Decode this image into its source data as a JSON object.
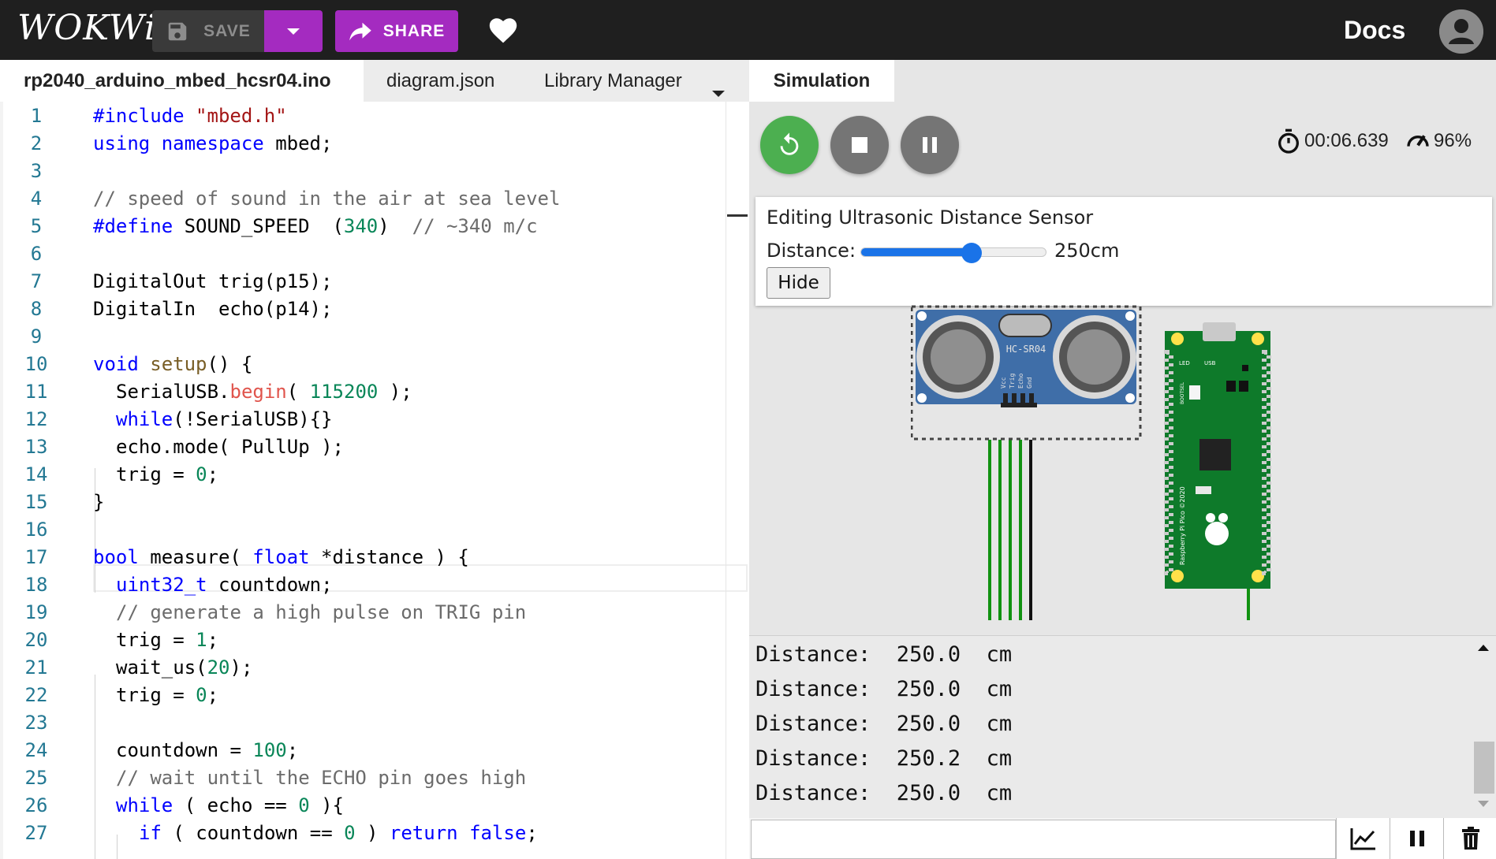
{
  "app": {
    "logo_text": "WOKWi",
    "save_label": "SAVE",
    "share_label": "SHARE",
    "docs_label": "Docs",
    "accent_color": "#a42bc0"
  },
  "editor": {
    "tabs": [
      {
        "label": "rp2040_arduino_mbed_hcsr04.ino",
        "active": true
      },
      {
        "label": "diagram.json",
        "active": false
      },
      {
        "label": "Library Manager",
        "active": false
      }
    ],
    "current_line": 14,
    "lines": [
      {
        "n": "1"
      },
      {
        "n": "2"
      },
      {
        "n": "3"
      },
      {
        "n": "4"
      },
      {
        "n": "5"
      },
      {
        "n": "6"
      },
      {
        "n": "7"
      },
      {
        "n": "8"
      },
      {
        "n": "9"
      },
      {
        "n": "10"
      },
      {
        "n": "11"
      },
      {
        "n": "12"
      },
      {
        "n": "13"
      },
      {
        "n": "14"
      },
      {
        "n": "15"
      },
      {
        "n": "16"
      },
      {
        "n": "17"
      },
      {
        "n": "18"
      },
      {
        "n": "19"
      },
      {
        "n": "20"
      },
      {
        "n": "21"
      },
      {
        "n": "22"
      },
      {
        "n": "23"
      },
      {
        "n": "24"
      },
      {
        "n": "25"
      },
      {
        "n": "26"
      },
      {
        "n": "27"
      }
    ],
    "code": {
      "l1": [
        "#include",
        " ",
        "\"mbed.h\""
      ],
      "l2": [
        "using",
        " ",
        "namespace",
        " mbed;"
      ],
      "l4": "// speed of sound in the air at sea level",
      "l5": [
        "#define",
        " SOUND_SPEED  (",
        "340",
        ")  ",
        "// ~340 m/c"
      ],
      "l7": "DigitalOut trig(p15);",
      "l8": "DigitalIn  echo(p14);",
      "l10": [
        "void",
        " ",
        "setup",
        "() {"
      ],
      "l11": [
        "SerialUSB.",
        "begin",
        "( ",
        "115200",
        " );"
      ],
      "l12": [
        "while",
        "(!SerialUSB){}"
      ],
      "l13": "echo.mode( PullUp );",
      "l14": [
        "trig = ",
        "0",
        ";"
      ],
      "l15": "}",
      "l17": [
        "bool",
        " measure( ",
        "float",
        " *distance ) {"
      ],
      "l18": [
        "uint32_t",
        " countdown;"
      ],
      "l19": "// generate a high pulse on TRIG pin",
      "l20": [
        "trig = ",
        "1",
        ";"
      ],
      "l21": [
        "wait_us(",
        "20",
        ");"
      ],
      "l22": [
        "trig = ",
        "0",
        ";"
      ],
      "l24": [
        "countdown = ",
        "100",
        ";"
      ],
      "l25": "// wait until the ECHO pin goes high",
      "l26": [
        "while",
        " ( echo == ",
        "0",
        " ){"
      ],
      "l27": [
        "if",
        " ( countdown == ",
        "0",
        " ) ",
        "return",
        " ",
        "false",
        ";"
      ]
    }
  },
  "simulation": {
    "tab_label": "Simulation",
    "timer": "00:06.639",
    "performance": "96%",
    "editor_popup": {
      "title": "Editing Ultrasonic Distance Sensor",
      "distance_label": "Distance:",
      "distance_value": "250cm",
      "slider_fraction": 0.6,
      "hide_label": "Hide"
    },
    "sensor_label": "HC-SR04",
    "sensor_pins": [
      "Vcc",
      "Trig",
      "Echo",
      "Gnd"
    ],
    "board_labels": {
      "led": "LED",
      "usb": "USB",
      "bootsel": "BOOTSEL",
      "side": "Raspberry Pi Pico ©2020"
    }
  },
  "serial": {
    "lines": [
      "Distance:  250.0  cm",
      "Distance:  250.0  cm",
      "Distance:  250.0  cm",
      "Distance:  250.2  cm",
      "Distance:  250.0  cm"
    ]
  }
}
